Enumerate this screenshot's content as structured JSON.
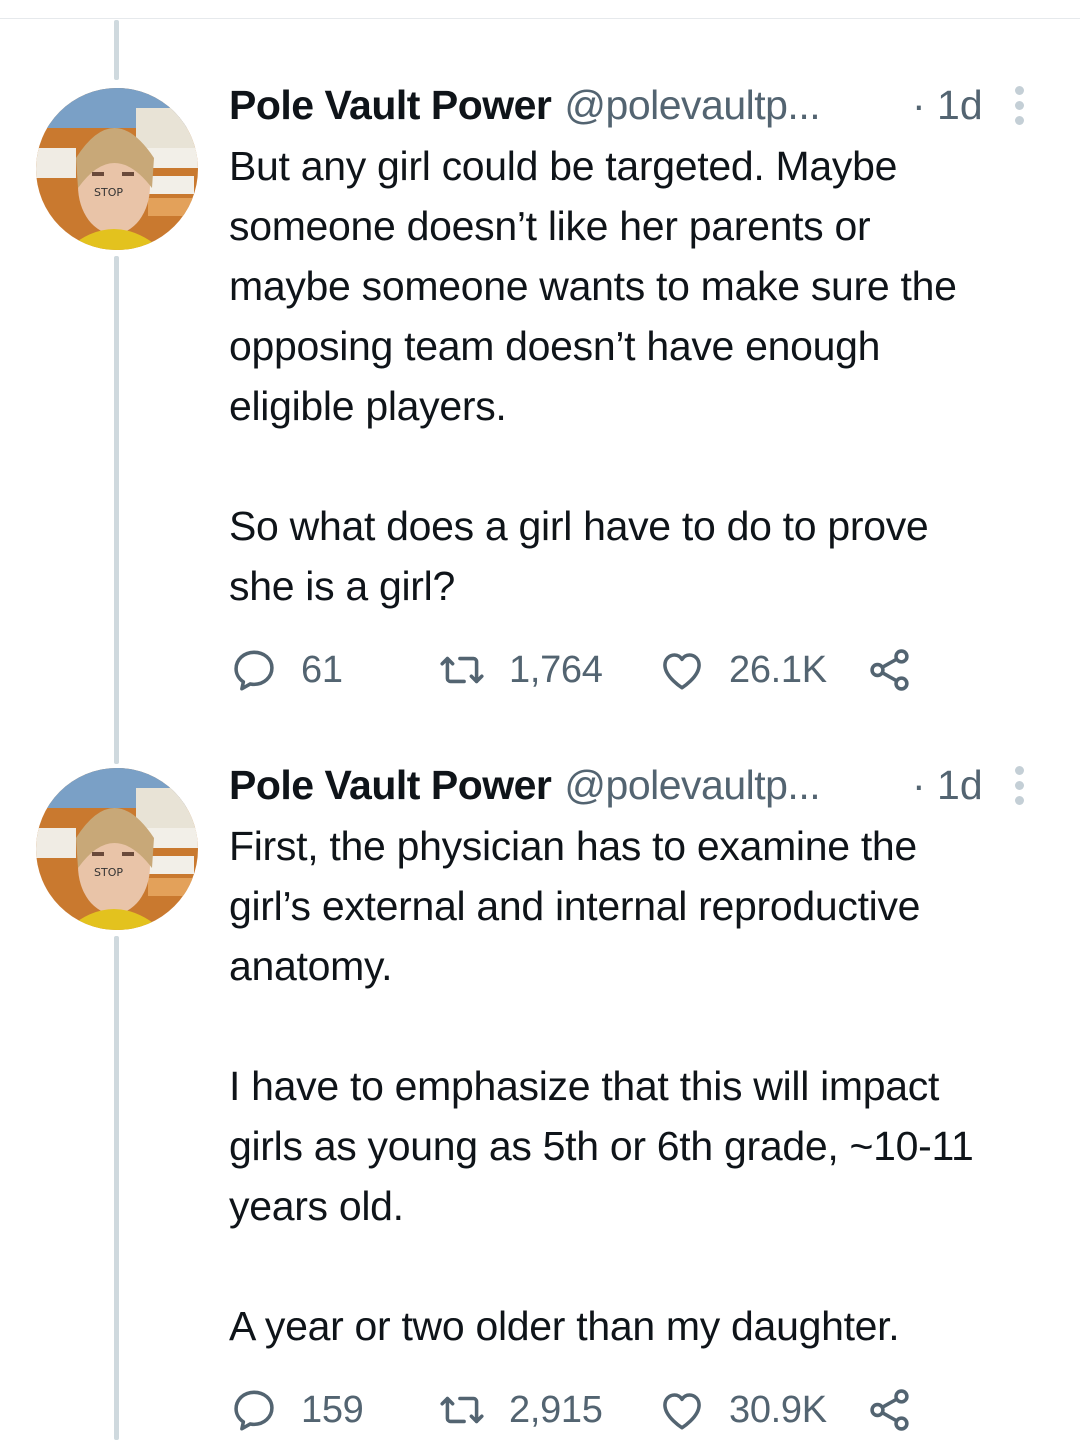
{
  "tweets": [
    {
      "display_name": "Pole Vault Power",
      "handle": "@polevaultp...",
      "time": "· 1d",
      "paragraphs": [
        "But any girl could be targeted. Maybe\nsomeone doesn’t like her parents or\nmaybe someone wants to make sure the\nopposing team doesn’t have enough\neligible players.",
        "So what does a girl have to do to prove\nshe is a girl?"
      ],
      "stats": {
        "replies": "61",
        "retweets": "1,764",
        "likes": "26.1K"
      }
    },
    {
      "display_name": "Pole Vault Power",
      "handle": "@polevaultp...",
      "time": "· 1d",
      "paragraphs": [
        "First, the physician has to examine the\ngirl’s external and internal reproductive\nanatomy.",
        "I have to emphasize that this will impact\ngirls as young as 5th or 6th grade, ~10-11\nyears old.",
        "A year or two older than my daughter."
      ],
      "stats": {
        "replies": "159",
        "retweets": "2,915",
        "likes": "30.9K"
      }
    }
  ],
  "icons": {
    "reply": "reply-icon",
    "retweet": "retweet-icon",
    "like": "heart-icon",
    "share": "share-icon",
    "more": "more-vertical-icon"
  },
  "colors": {
    "text_primary": "#0f1419",
    "text_secondary": "#536471",
    "thread_line": "#cfd9de"
  }
}
